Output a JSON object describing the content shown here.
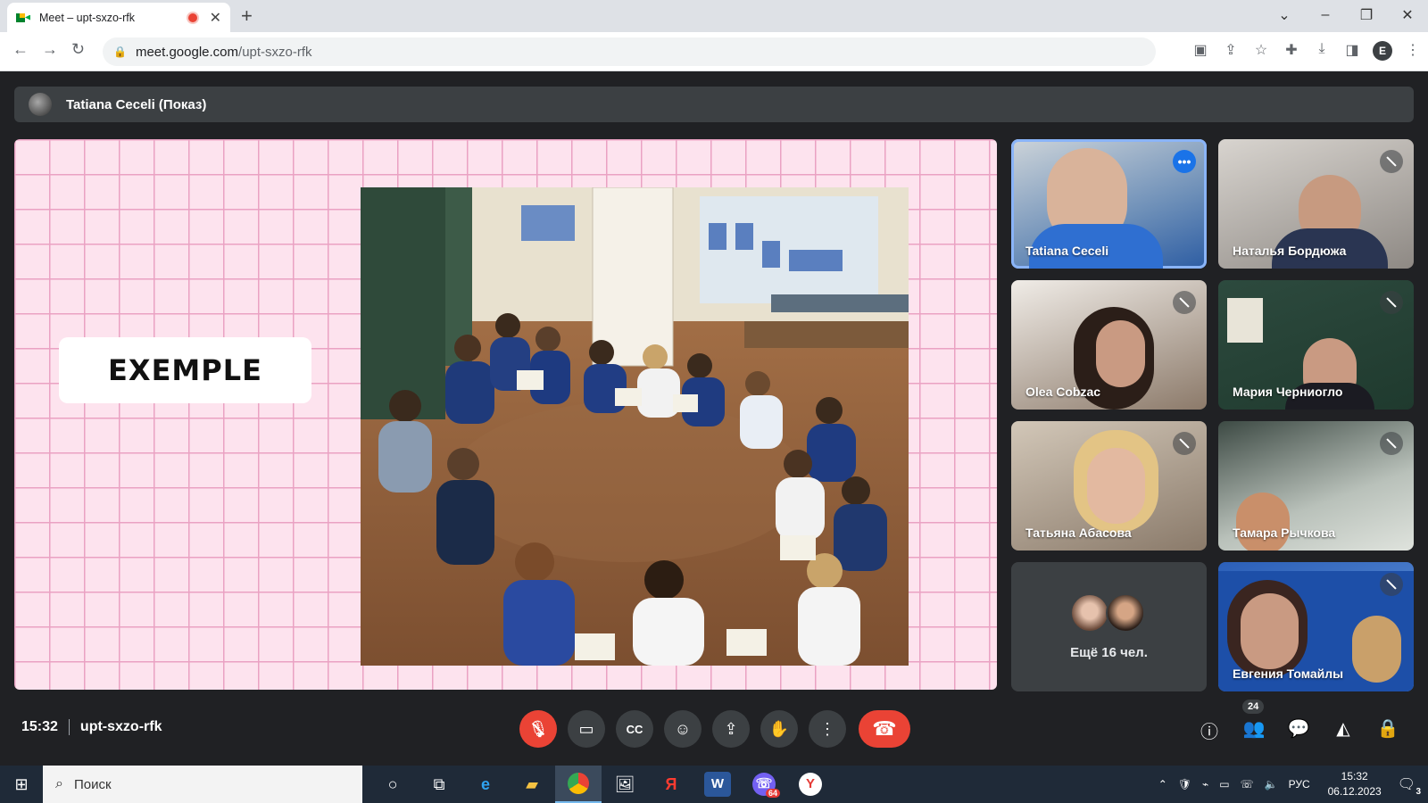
{
  "browser": {
    "tab_title": "Meet – upt-sxzo-rfk",
    "new_tab": "+",
    "url_host": "meet.google.com",
    "url_path": "/upt-sxzo-rfk",
    "profile_initial": "E"
  },
  "meeting": {
    "presenter_banner": "Tatiana Ceceli (Показ)",
    "slide_label": "EXEMPLE",
    "time": "15:32",
    "code": "upt-sxzo-rfk",
    "participant_count": "24"
  },
  "participants": [
    {
      "name": "Tatiana Ceceli",
      "muted": false,
      "active": true
    },
    {
      "name": "Наталья Бордюжа",
      "muted": true
    },
    {
      "name": "Olea Cobzac",
      "muted": true
    },
    {
      "name": "Мария Черниогло",
      "muted": true
    },
    {
      "name": "Татьяна Абасова",
      "muted": true
    },
    {
      "name": "Тамара Рычкова",
      "muted": true
    },
    {
      "name": "Евгения Томайлы",
      "muted": true
    }
  ],
  "more_participants": "Ещё 16 чел.",
  "taskbar": {
    "search_placeholder": "Поиск",
    "viber_badge": "64",
    "lang": "РУС",
    "clock_time": "15:32",
    "clock_date": "06.12.2023",
    "notif_count": "3"
  },
  "colors": {
    "meet_bg": "#202124",
    "end_call": "#ea4335",
    "active_outline": "#8ab4f8",
    "slide_bg": "#fde3ee"
  }
}
